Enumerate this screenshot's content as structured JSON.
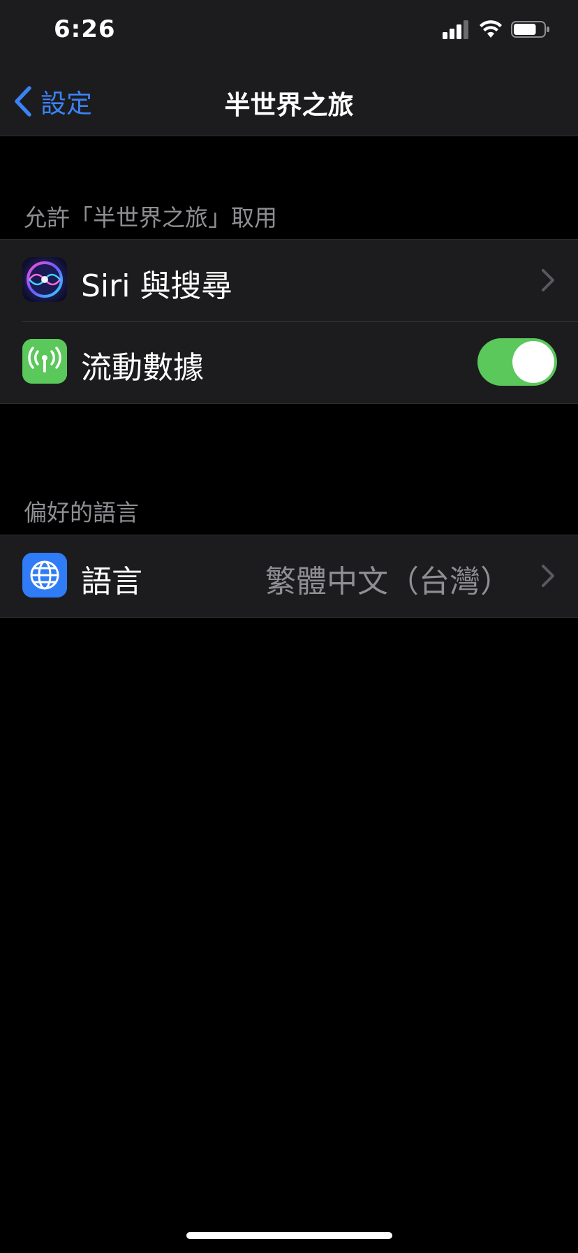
{
  "status_bar": {
    "time": "6:26",
    "battery_level_percent": 75
  },
  "nav": {
    "back_label": "設定",
    "title": "半世界之旅"
  },
  "sections": [
    {
      "header": "允許「半世界之旅」取用",
      "rows": [
        {
          "label": "Siri 與搜尋",
          "icon": "siri-icon",
          "accessory": "chevron"
        },
        {
          "label": "流動數據",
          "icon": "cellular-antenna-icon",
          "accessory": "toggle",
          "toggle_on": true
        }
      ]
    },
    {
      "header": "偏好的語言",
      "rows": [
        {
          "label": "語言",
          "value": "繁體中文（台灣）",
          "icon": "globe-icon",
          "accessory": "chevron"
        }
      ]
    }
  ],
  "colors": {
    "background": "#000000",
    "cell_background": "#1c1c1e",
    "accent_blue": "#3b82f6",
    "toggle_green": "#5ac85a",
    "secondary_text": "#8e8e93",
    "cellular_icon_bg": "#5ac85a",
    "globe_icon_bg": "#2f7cf6"
  }
}
